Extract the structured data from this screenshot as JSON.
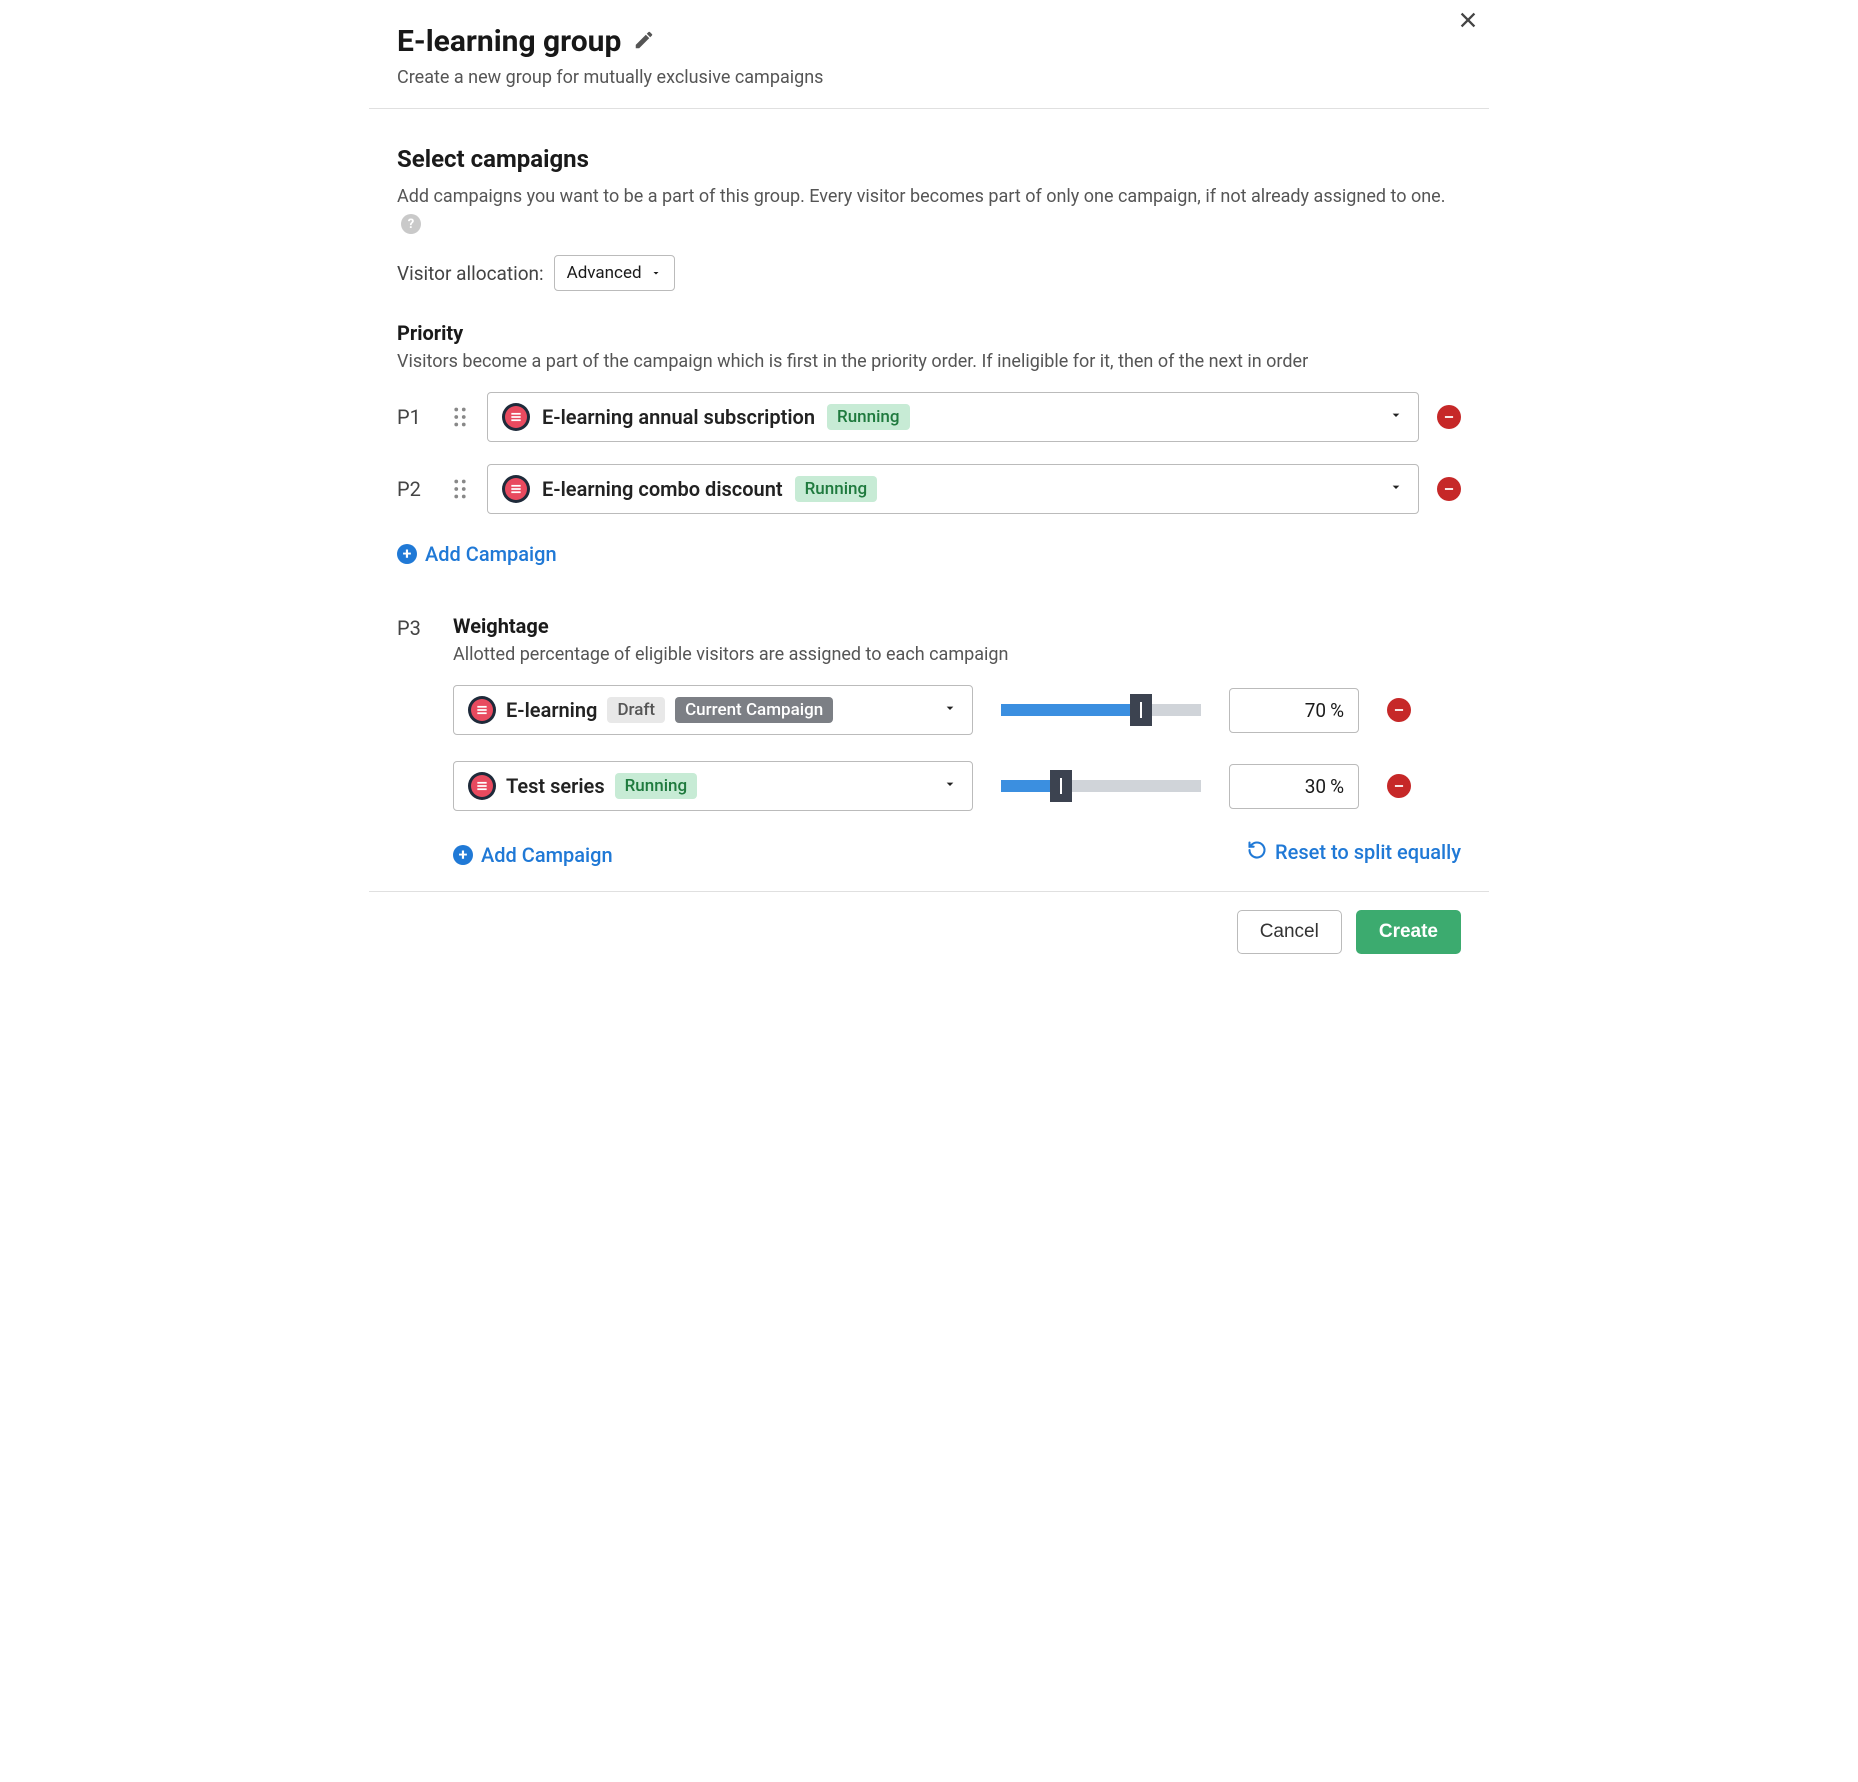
{
  "header": {
    "title": "E-learning group",
    "subtitle": "Create a new group for mutually exclusive campaigns"
  },
  "select_campaigns": {
    "title": "Select campaigns",
    "desc": "Add campaigns you want to be a part of this group. Every visitor becomes part of only one campaign, if not already assigned to one."
  },
  "visitor_allocation": {
    "label": "Visitor allocation:",
    "value": "Advanced"
  },
  "priority": {
    "title": "Priority",
    "desc": "Visitors become a part of the campaign which is first in the priority order. If ineligible for it, then of the next in order",
    "rows": [
      {
        "p": "P1",
        "name": "E-learning annual subscription",
        "status": "Running"
      },
      {
        "p": "P2",
        "name": "E-learning combo discount",
        "status": "Running"
      }
    ],
    "add_label": "Add Campaign"
  },
  "weightage": {
    "p": "P3",
    "title": "Weightage",
    "desc": "Allotted percentage of eligible visitors are assigned to each campaign",
    "rows": [
      {
        "name": "E-learning",
        "status": "Draft",
        "extra": "Current Campaign",
        "percent": "70"
      },
      {
        "name": "Test series",
        "status": "Running",
        "extra": "",
        "percent": "30"
      }
    ],
    "add_label": "Add Campaign",
    "reset_label": "Reset to split equally",
    "percent_symbol": "%"
  },
  "footer": {
    "cancel": "Cancel",
    "create": "Create"
  }
}
